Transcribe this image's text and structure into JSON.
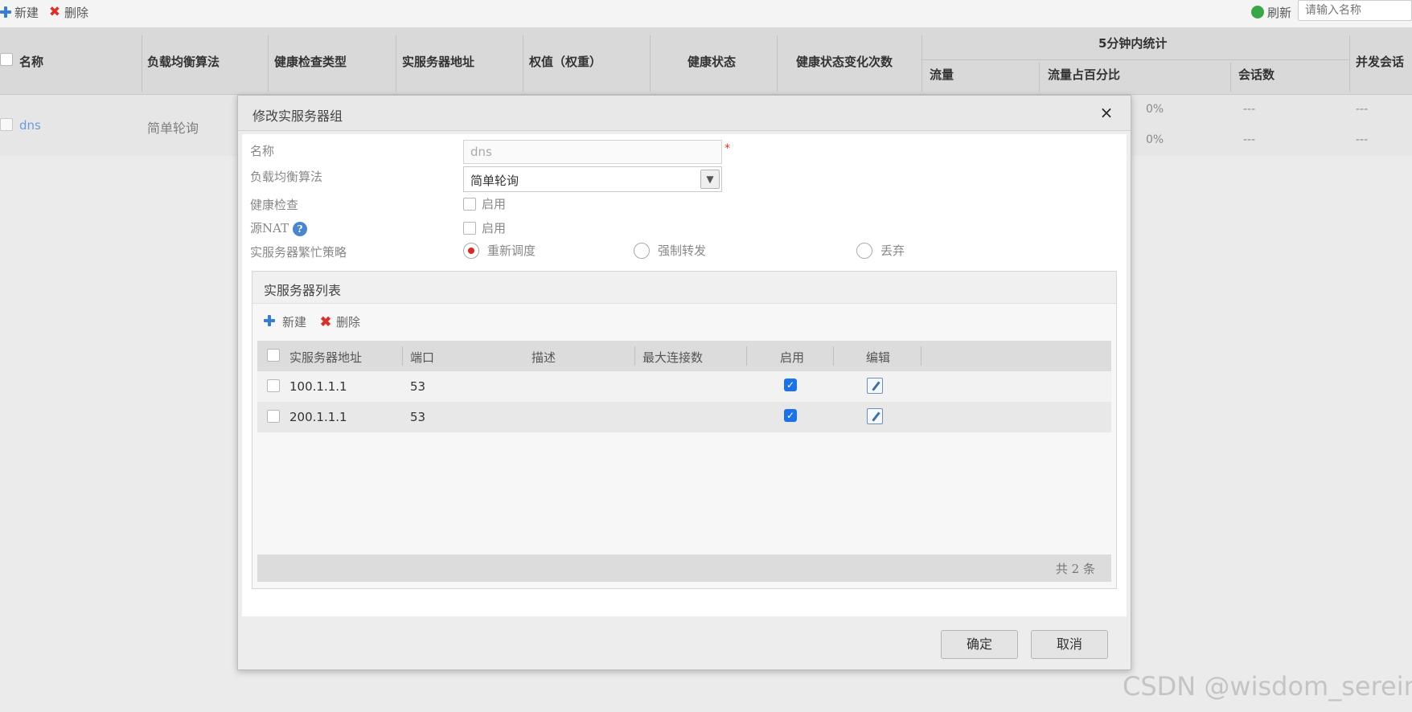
{
  "toolbar": {
    "new_label": "新建",
    "delete_label": "删除",
    "refresh_label": "刷新",
    "search_placeholder": "请输入名称"
  },
  "grid": {
    "columns": [
      "名称",
      "负载均衡算法",
      "健康检查类型",
      "实服务器地址",
      "权值（权重）",
      "健康状态",
      "健康状态变化次数"
    ],
    "stats_group": "5分钟内统计",
    "stats_columns": [
      "流量",
      "流量占百分比",
      "会话数"
    ],
    "last_column": "并发会话",
    "rows": [
      {
        "name": "dns",
        "algorithm": "简单轮询",
        "percent_1": "0%",
        "percent_2": "0%",
        "sessions_1": "---",
        "sessions_2": "---",
        "concurrent_1": "---",
        "concurrent_2": "---"
      }
    ]
  },
  "dialog": {
    "title": "修改实服务器组",
    "close_symbol": "×",
    "fields": {
      "name_label": "名称",
      "name_value": "dns",
      "algorithm_label": "负载均衡算法",
      "algorithm_value": "简单轮询",
      "health_check_label": "健康检查",
      "health_check_option": "启用",
      "snat_label": "源NAT",
      "snat_option": "启用",
      "busy_policy_label": "实服务器繁忙策略",
      "busy_policy_options": [
        "重新调度",
        "强制转发",
        "丢弃"
      ],
      "busy_policy_selected": "重新调度"
    },
    "server_list": {
      "title": "实服务器列表",
      "new_label": "新建",
      "delete_label": "删除",
      "columns": [
        "实服务器地址",
        "端口",
        "描述",
        "最大连接数",
        "启用",
        "编辑"
      ],
      "rows": [
        {
          "address": "100.1.1.1",
          "port": "53",
          "description": "",
          "max_conn": "",
          "enabled": true
        },
        {
          "address": "200.1.1.1",
          "port": "53",
          "description": "",
          "max_conn": "",
          "enabled": true
        }
      ],
      "total": "共 2 条"
    },
    "ok_label": "确定",
    "cancel_label": "取消"
  },
  "watermark": "CSDN @wisdom_serein",
  "colors": {
    "link": "#2a6fd6",
    "delete_icon": "#d8322a",
    "add_icon": "#3a7bd5",
    "radio_selected": "#d9282a"
  }
}
